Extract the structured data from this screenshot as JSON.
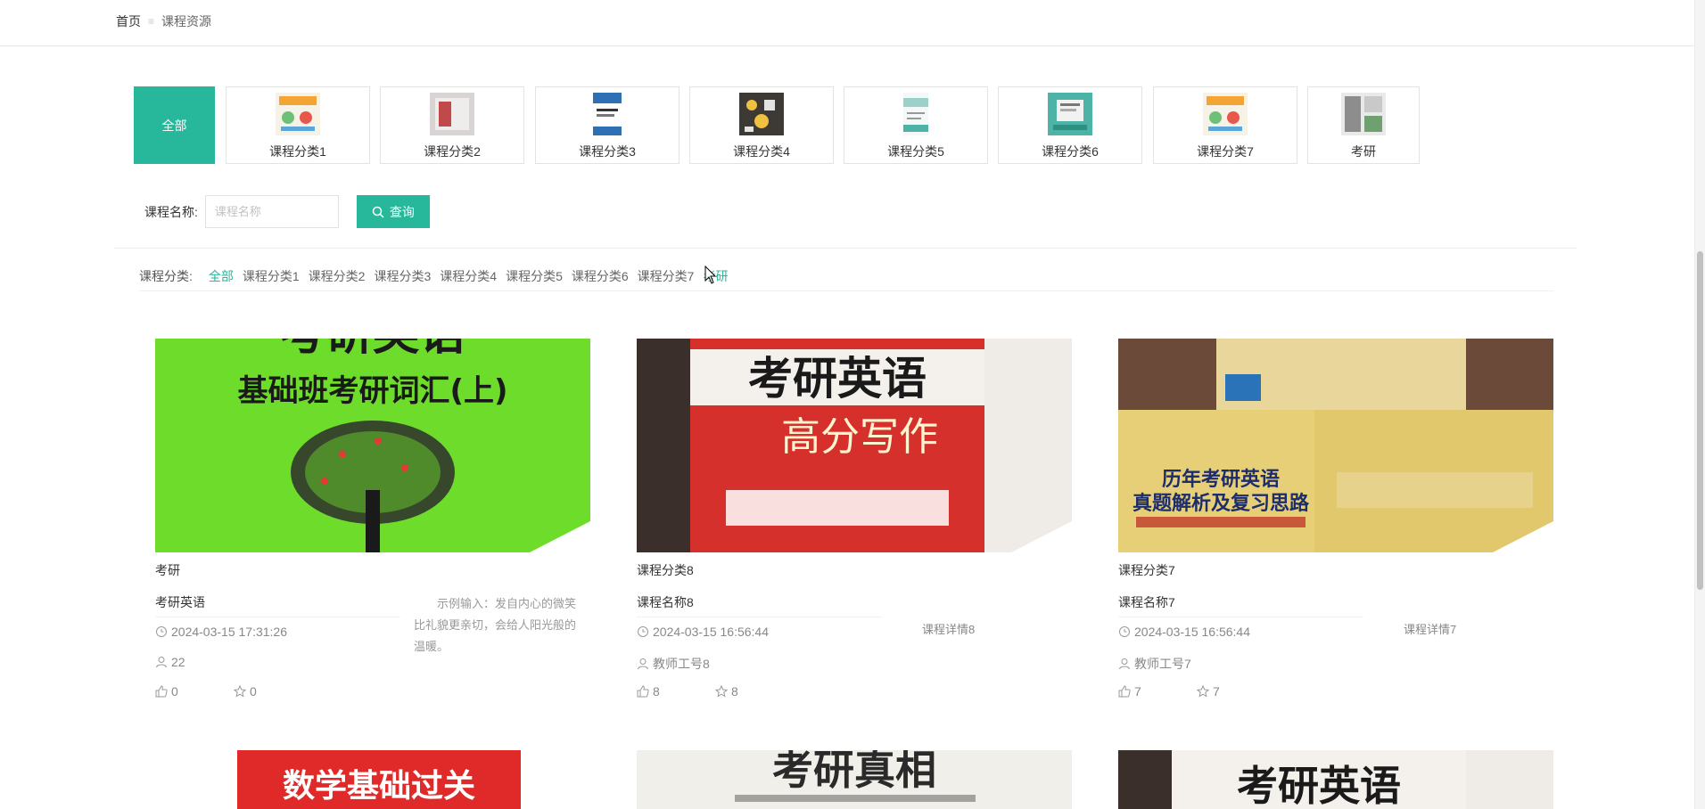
{
  "breadcrumb": {
    "home": "首页",
    "separator": "≡",
    "current": "课程资源"
  },
  "categories": {
    "all_label": "全部",
    "tiles": [
      {
        "label": "课程分类1",
        "thumb_color": "#f2a535"
      },
      {
        "label": "课程分类2",
        "thumb_color": "#b9b4b4"
      },
      {
        "label": "课程分类3",
        "thumb_color": "#2f6fb3"
      },
      {
        "label": "课程分类4",
        "thumb_color": "#3d3a35"
      },
      {
        "label": "课程分类5",
        "thumb_color": "#9bd1c8"
      },
      {
        "label": "课程分类6",
        "thumb_color": "#4cb3a6"
      },
      {
        "label": "课程分类7",
        "thumb_color": "#f2a535"
      },
      {
        "label": "考研",
        "thumb_color": "#8d8d8d"
      }
    ]
  },
  "search": {
    "label": "课程名称:",
    "placeholder": "课程名称",
    "button_label": "查询"
  },
  "filter": {
    "label": "课程分类:",
    "options": [
      "全部",
      "课程分类1",
      "课程分类2",
      "课程分类3",
      "课程分类4",
      "课程分类5",
      "课程分类6",
      "课程分类7",
      "考研"
    ],
    "active": "全部"
  },
  "courses": [
    {
      "category": "考研",
      "name": "考研英语",
      "time": "2024-03-15 17:31:26",
      "teacher": "22",
      "likes": "0",
      "favorites": "0",
      "description": "示例输入：发自内心的微笑比礼貌更亲切，会给人阳光般的温暖。",
      "detail": "",
      "image_text": {
        "line1": "考研英语",
        "line2": "基础班考研词汇(上)"
      }
    },
    {
      "category": "课程分类8",
      "name": "课程名称8",
      "time": "2024-03-15 16:56:44",
      "teacher": "教师工号8",
      "likes": "8",
      "favorites": "8",
      "description": "",
      "detail": "课程详情8",
      "image_text": {
        "line1": "考研英语",
        "line2": "高分写作"
      }
    },
    {
      "category": "课程分类7",
      "name": "课程名称7",
      "time": "2024-03-15 16:56:44",
      "teacher": "教师工号7",
      "likes": "7",
      "favorites": "7",
      "description": "",
      "detail": "课程详情7",
      "image_text": {
        "line1": "历年考研英语",
        "line2": "真题解析及复习思路"
      }
    }
  ],
  "next_row": [
    {
      "image_text": "数学基础过关"
    },
    {
      "image_text": "考研真相"
    },
    {
      "image_text": "考研英语"
    }
  ],
  "colors": {
    "accent": "#27b79b"
  }
}
